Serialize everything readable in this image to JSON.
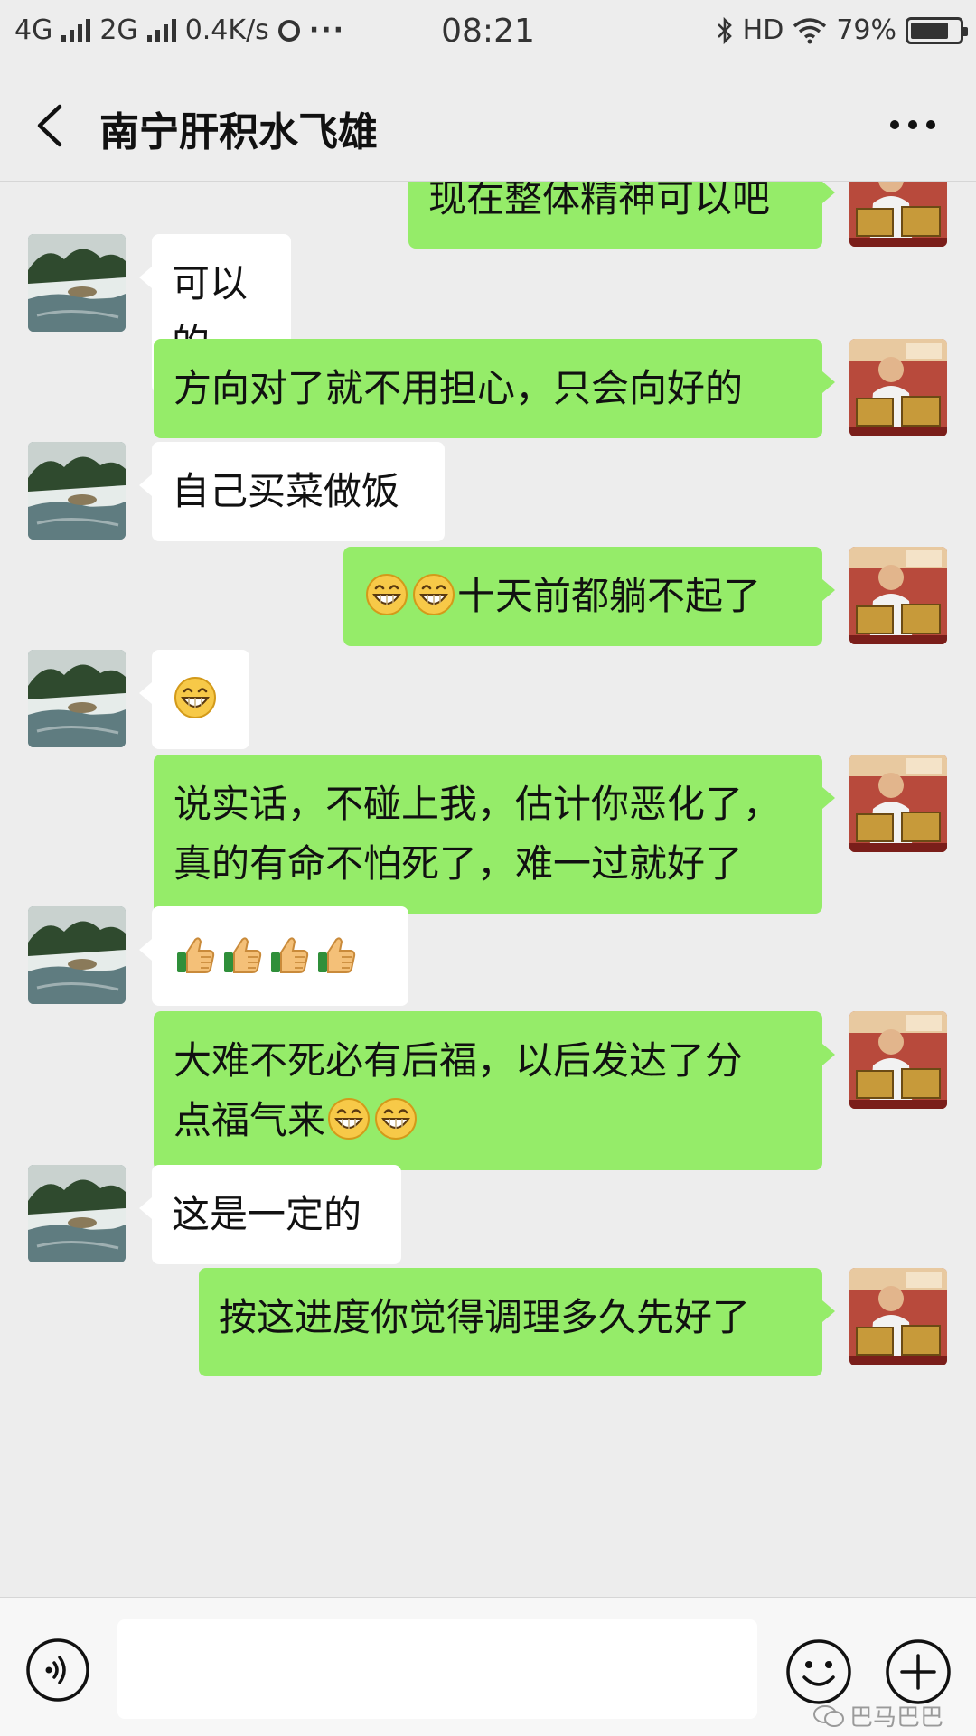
{
  "status_bar": {
    "network1": "4G",
    "network2": "2G",
    "speed": "0.4K/s",
    "more": "···",
    "time": "08:21",
    "hd": "HD",
    "battery": "79%",
    "battery_level": 0.79
  },
  "header": {
    "title": "南宁肝积水飞雄"
  },
  "messages": [
    {
      "side": "out",
      "text": "现在整体精神可以吧"
    },
    {
      "side": "in",
      "text": "可以的"
    },
    {
      "side": "out",
      "text": "方向对了就不用担心，只会向好的"
    },
    {
      "side": "in",
      "text": "自己买菜做饭"
    },
    {
      "side": "out",
      "text": "十天前都躺不起了",
      "emojis_before": [
        "grin-emoji",
        "grin-emoji"
      ]
    },
    {
      "side": "in",
      "text": "",
      "emojis_before": [
        "grin-emoji"
      ]
    },
    {
      "side": "out",
      "text": "说实话，不碰上我，估计你恶化了，\n真的有命不怕死了，难一过就好了"
    },
    {
      "side": "in",
      "text": "",
      "emojis_before": [
        "thumbs-up-emoji",
        "thumbs-up-emoji",
        "thumbs-up-emoji",
        "thumbs-up-emoji"
      ]
    },
    {
      "side": "out",
      "text": "大难不死必有后福，以后发达了分\n点福气来",
      "emojis_after": [
        "grin-emoji",
        "grin-emoji"
      ]
    },
    {
      "side": "in",
      "text": "这是一定的"
    },
    {
      "side": "out",
      "text": "按这进度你觉得调理多久先好了"
    }
  ],
  "input": {
    "placeholder": ""
  },
  "watermark": {
    "text": "巴马巴巴"
  },
  "colors": {
    "background": "#ededed",
    "outgoing_bubble": "#95ec69",
    "incoming_bubble": "#ffffff"
  }
}
